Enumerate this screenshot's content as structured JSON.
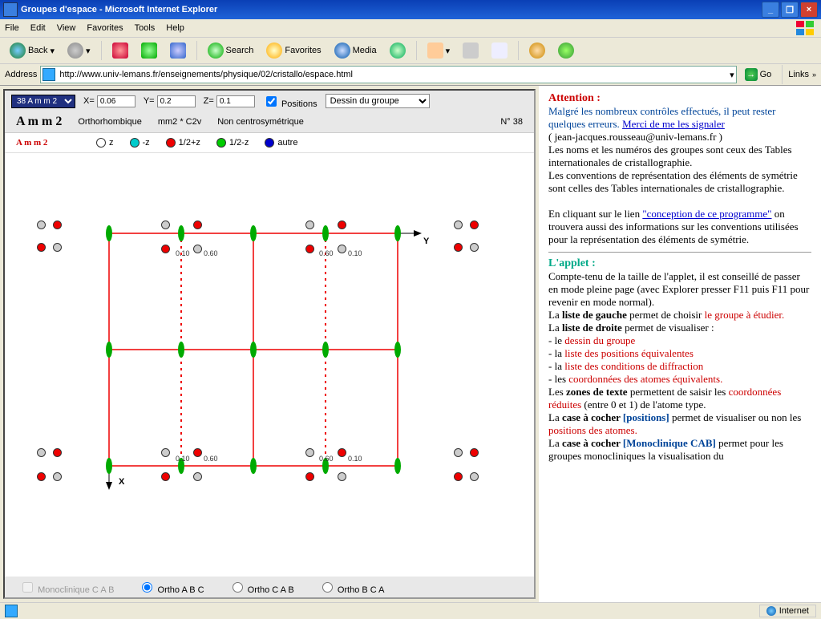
{
  "window": {
    "title": "Groupes d'espace - Microsoft Internet Explorer",
    "min": "_",
    "max": "❐",
    "close": "×"
  },
  "menu": {
    "file": "File",
    "edit": "Edit",
    "view": "View",
    "favorites": "Favorites",
    "tools": "Tools",
    "help": "Help"
  },
  "toolbar": {
    "back": "Back",
    "search": "Search",
    "favorites": "Favorites",
    "media": "Media"
  },
  "address": {
    "label": "Address",
    "url": "http://www.univ-lemans.fr/enseignements/physique/02/cristallo/espace.html",
    "go": "Go",
    "links": "Links"
  },
  "applet": {
    "group_select": "38  A m m 2",
    "X_label": "X=",
    "X": "0.06",
    "Y_label": "Y=",
    "Y": "0.2",
    "Z_label": "Z=",
    "Z": "0.1",
    "positions": "Positions",
    "draw_select": "Dessin du groupe",
    "info": {
      "name": "A m m 2",
      "system": "Orthorhombique",
      "class": "mm2 * C2v",
      "centro": "Non centrosymétrique",
      "num": "N° 38"
    },
    "legend": {
      "name": "A m m 2",
      "z": "z",
      "mz": "-z",
      "hpz": "1/2+z",
      "hmz": "1/2-z",
      "autre": "autre"
    },
    "coords": {
      "a": "0.10",
      "b": "0.60"
    },
    "axes": {
      "x": "X",
      "y": "Y"
    },
    "radios": {
      "mono": "Monoclinique C A B",
      "oabc": "Ortho A B C",
      "ocab": "Ortho C A B",
      "obca": "Ortho B C A"
    }
  },
  "side": {
    "attn": "Attention :",
    "p1a": "Malgré les nombreux contrôles effectués, il peut rester quelques erreurs.",
    "p1b": "Merci de me les signaler",
    "email": "( jean-jacques.rousseau@univ-lemans.fr )",
    "p2": "Les noms et les numéros des groupes sont ceux des Tables internationales de cristallographie.",
    "p3": "Les conventions de représentation des éléments de symétrie sont celles des Tables internationales de cristallographie.",
    "p4a": "En cliquant sur le lien",
    "p4b": "\"conception de ce programme\"",
    "p4c": "on trouvera aussi des informations sur les conventions utilisées pour la représentation des éléments de symétrie.",
    "applet_h": "L'applet :",
    "a1": "Compte-tenu de la taille de l'applet, il est conseillé de passer en mode pleine page (avec Explorer presser F11 puis F11 pour revenir en mode normal).",
    "a2a": "La ",
    "a2b": "liste de gauche",
    "a2c": " permet de choisir ",
    "a2d": "le groupe à étudier.",
    "a3a": "La ",
    "a3b": "liste de droite",
    "a3c": " permet de visualiser :",
    "li1": "- le ",
    "li1b": "dessin du groupe",
    "li2": "- la ",
    "li2b": "liste des positions équivalentes",
    "li3": "- la ",
    "li3b": "liste des conditions de diffraction",
    "li4": "- les ",
    "li4b": "coordonnées des atomes équivalents.",
    "a4a": " Les ",
    "a4b": "zones de texte",
    "a4c": " permettent de saisir les ",
    "a4d": "coordonnées réduites",
    "a4e": " (entre 0 et 1) de l'atome type.",
    "a5a": "La ",
    "a5b": "case à cocher ",
    "a5c": "[positions]",
    "a5d": " permet de visualiser ou non les ",
    "a5e": "positions des atomes.",
    "a6a": " La ",
    "a6b": "case à cocher ",
    "a6c": "[Monoclinique CAB]",
    "a6d": " permet pour les groupes monocliniques la visualisation du"
  },
  "status": {
    "zone": "Internet"
  }
}
